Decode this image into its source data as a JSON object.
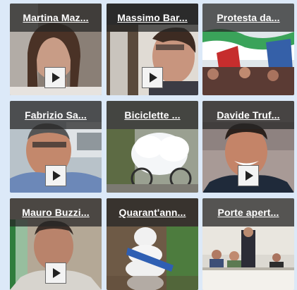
{
  "videos": [
    {
      "title": "Martina Maz...",
      "has_play": true
    },
    {
      "title": "Massimo Bar...",
      "has_play": true
    },
    {
      "title": "Protesta da...",
      "has_play": false
    },
    {
      "title": "Fabrizio Sa...",
      "has_play": true
    },
    {
      "title": "Biciclette ...",
      "has_play": false
    },
    {
      "title": "Davide Truf...",
      "has_play": true
    },
    {
      "title": "Mauro Buzzi...",
      "has_play": true
    },
    {
      "title": "Quarant'ann...",
      "has_play": false
    },
    {
      "title": "Porte apert...",
      "has_play": false
    }
  ],
  "icons": {
    "play": "play-icon"
  }
}
